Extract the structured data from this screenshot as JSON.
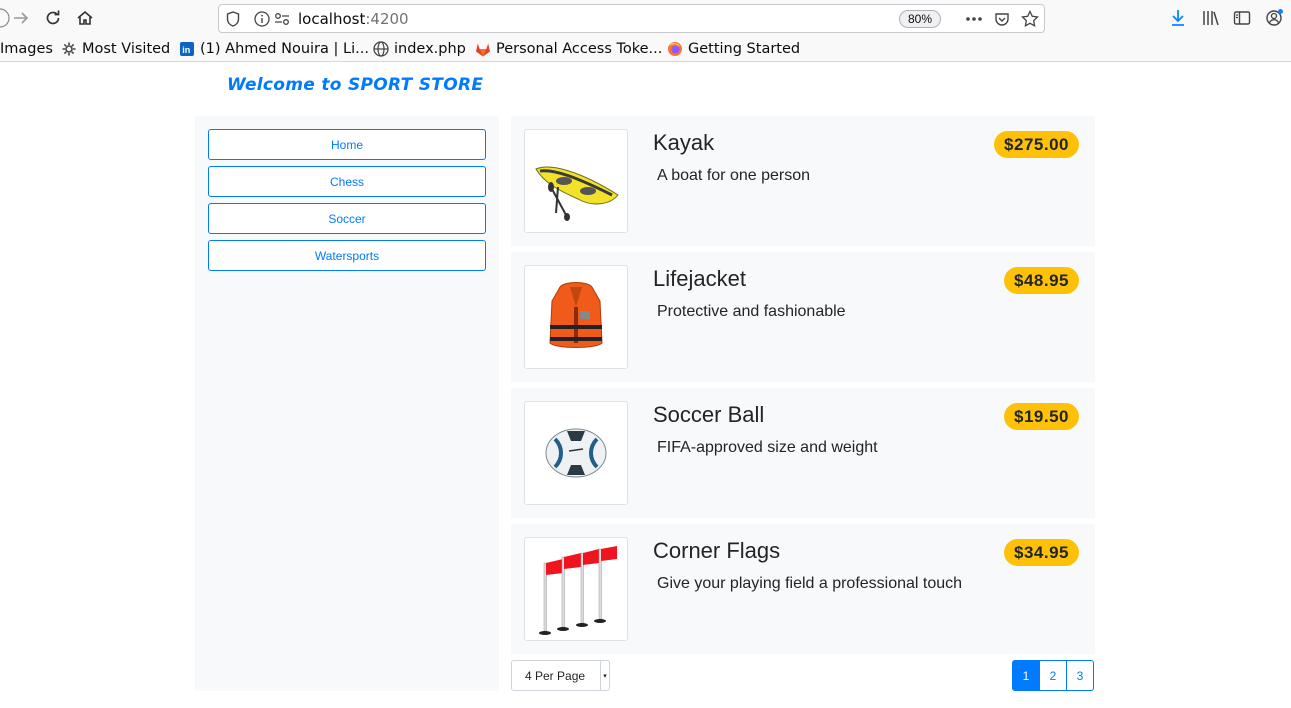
{
  "browser": {
    "url_host": "localhost",
    "url_port": ":4200",
    "zoom": "80%",
    "bookmarks": [
      {
        "label": "Images",
        "icon": "none"
      },
      {
        "label": "Most Visited",
        "icon": "gear-icon"
      },
      {
        "label": "(1) Ahmed Nouira | Li...",
        "icon": "linkedin-icon"
      },
      {
        "label": "index.php",
        "icon": "globe-icon"
      },
      {
        "label": "Personal Access Toke...",
        "icon": "gitlab-icon"
      },
      {
        "label": "Getting Started",
        "icon": "firefox-icon"
      }
    ]
  },
  "store": {
    "title": "Welcome to SPORT STORE",
    "categories": [
      "Home",
      "Chess",
      "Soccer",
      "Watersports"
    ],
    "products": [
      {
        "name": "Kayak",
        "description": "A boat for one person",
        "price": "$275.00",
        "image": "kayak-image"
      },
      {
        "name": "Lifejacket",
        "description": "Protective and fashionable",
        "price": "$48.95",
        "image": "lifejacket-image"
      },
      {
        "name": "Soccer Ball",
        "description": "FIFA-approved size and weight",
        "price": "$19.50",
        "image": "soccer-ball-image"
      },
      {
        "name": "Corner Flags",
        "description": "Give your playing field a professional touch",
        "price": "$34.95",
        "image": "corner-flags-image"
      }
    ],
    "per_page_label": "4 Per Page",
    "pages": [
      "1",
      "2",
      "3"
    ],
    "active_page": "1"
  },
  "colors": {
    "accent": "#007bff",
    "price_badge": "#ffc107",
    "panel": "#f8f9fa"
  }
}
